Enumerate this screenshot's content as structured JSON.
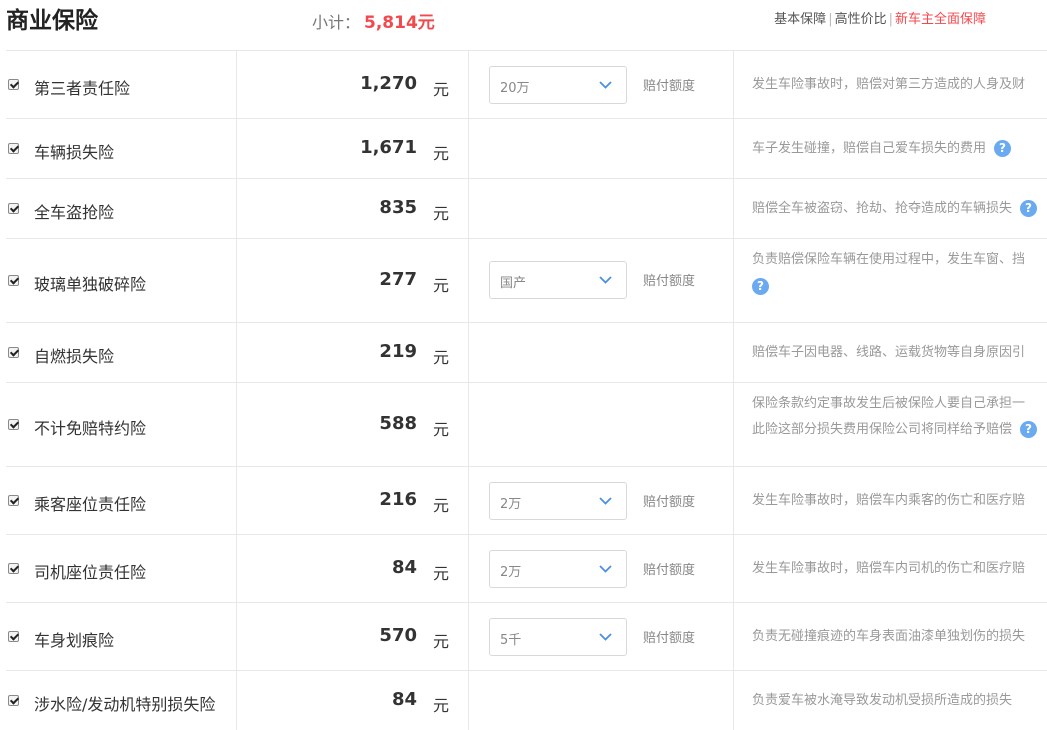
{
  "header": {
    "title": "商业保险",
    "subtotal_label": "小计：",
    "subtotal_value": "5,814元",
    "plans": [
      "基本保障",
      "高性价比",
      "新车主全面保障"
    ],
    "active_plan": "新车主全面保障"
  },
  "currency_unit": "元",
  "help_glyph": "?",
  "rows": [
    {
      "checked": true,
      "name": "第三者责任险",
      "price": "1,270",
      "select": "20万",
      "option_label": "赔付额度",
      "desc": [
        "发生车险事故时，赔偿对第三方造成的人身及财"
      ]
    },
    {
      "checked": true,
      "name": "车辆损失险",
      "price": "1,671",
      "desc": [
        "车子发生碰撞，赔偿自己爱车损失的费用"
      ]
    },
    {
      "checked": true,
      "name": "全车盗抢险",
      "price": "835",
      "desc": [
        "赔偿全车被盗窃、抢劫、抢夺造成的车辆损失"
      ]
    },
    {
      "checked": true,
      "name": "玻璃单独破碎险",
      "price": "277",
      "select": "国产",
      "option_label": "赔付额度",
      "desc": [
        "负责赔偿保险车辆在使用过程中，发生车窗、挡"
      ]
    },
    {
      "checked": true,
      "name": "自燃损失险",
      "price": "219",
      "desc": [
        "赔偿车子因电器、线路、运载货物等自身原因引"
      ]
    },
    {
      "checked": true,
      "name": "不计免赔特约险",
      "price": "588",
      "desc": [
        "保险条款约定事故发生后被保险人要自己承担一",
        "此险这部分损失费用保险公司将同样给予赔偿"
      ]
    },
    {
      "checked": true,
      "name": "乘客座位责任险",
      "price": "216",
      "select": "2万",
      "option_label": "赔付额度",
      "desc": [
        "发生车险事故时，赔偿车内乘客的伤亡和医疗赔"
      ]
    },
    {
      "checked": true,
      "name": "司机座位责任险",
      "price": "84",
      "select": "2万",
      "option_label": "赔付额度",
      "desc": [
        "发生车险事故时，赔偿车内司机的伤亡和医疗赔"
      ]
    },
    {
      "checked": true,
      "name": "车身划痕险",
      "price": "570",
      "select": "5千",
      "option_label": "赔付额度",
      "desc": [
        "负责无碰撞痕迹的车身表面油漆单独划伤的损失"
      ]
    },
    {
      "checked": true,
      "name": "涉水险/发动机特别损失险",
      "price": "84",
      "desc": [
        "负责爱车被水淹导致发动机受损所造成的损失"
      ]
    }
  ]
}
